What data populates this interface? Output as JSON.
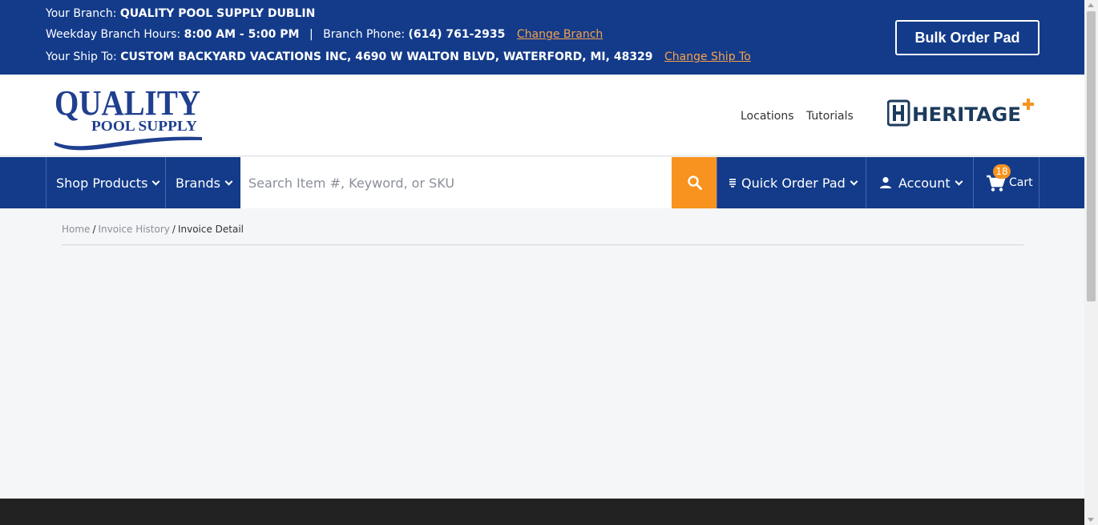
{
  "topbar": {
    "branch_label": "Your Branch:",
    "branch_name": "QUALITY POOL SUPPLY DUBLIN",
    "hours_label": "Weekday Branch Hours:",
    "hours_value": "8:00 AM - 5:00 PM",
    "separator": "|",
    "phone_label": "Branch Phone:",
    "phone_value": "(614) 761-2935",
    "change_branch": "Change Branch",
    "shipto_label": "Your Ship To:",
    "shipto_value": "CUSTOM BACKYARD VACATIONS INC, 4690 W WALTON BLVD, WATERFORD, MI, 48329",
    "change_shipto": "Change Ship To",
    "bulk_order_pad": "Bulk Order Pad"
  },
  "header": {
    "logo_text_line1": "QUALITY",
    "logo_text_line2": "POOL SUPPLY",
    "locations": "Locations",
    "tutorials": "Tutorials",
    "partner_logo_text": "HERITAGE"
  },
  "nav": {
    "shop_products": "Shop Products",
    "brands": "Brands",
    "search_placeholder": "Search Item #, Keyword, or SKU",
    "search_icon": "search-icon",
    "quick_order_pad": "Quick Order Pad",
    "account": "Account",
    "cart": "Cart",
    "cart_count": "18"
  },
  "breadcrumb": {
    "home": "Home",
    "sep": "/",
    "invoice_history": "Invoice History",
    "current": "Invoice Detail"
  },
  "colors": {
    "brand_blue": "#133b8a",
    "accent_orange": "#f7931e",
    "link_orange": "#f7a14a",
    "footer": "#212121"
  }
}
